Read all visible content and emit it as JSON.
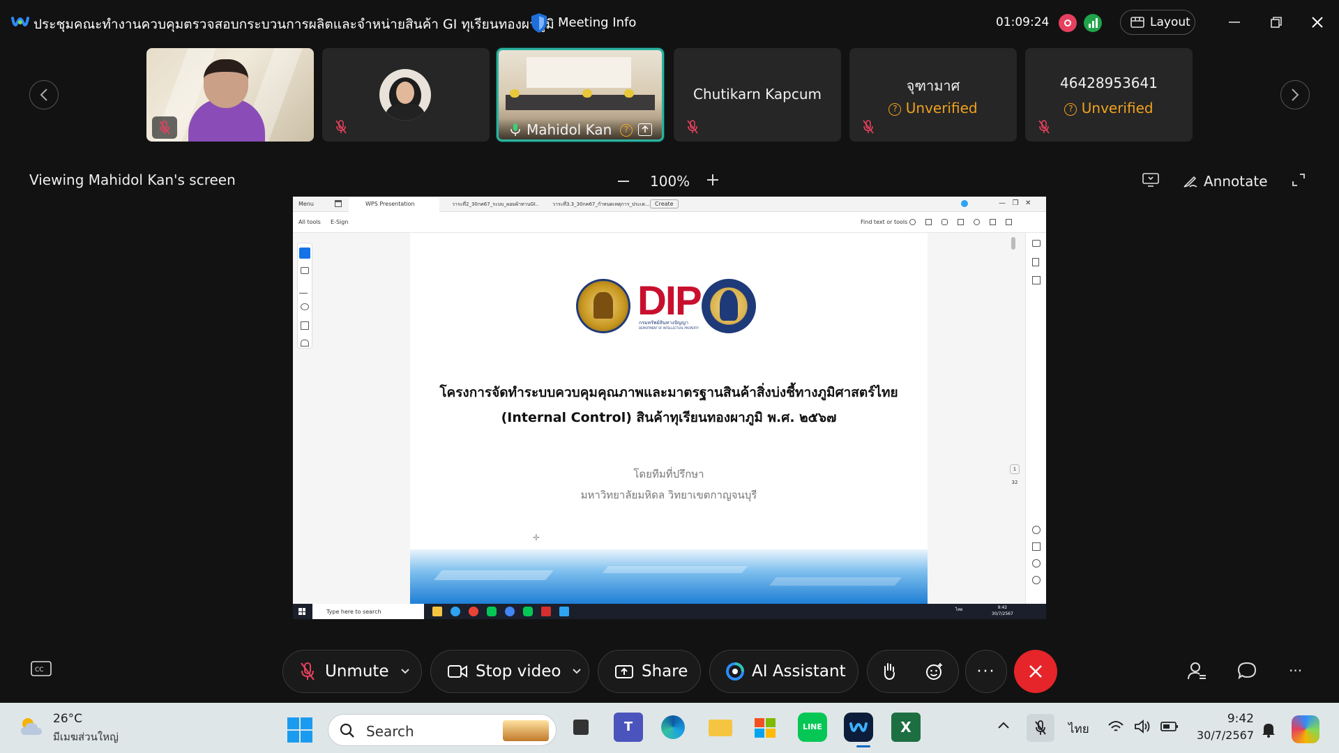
{
  "window": {
    "title": "ประชุมคณะทำงานควบคุมตรวจสอบกระบวนการผลิตและจำหน่ายสินค้า GI ทุเรียนทองผาภูมิ",
    "meeting_info_label": "Meeting Info",
    "timer": "01:09:24",
    "layout_label": "Layout"
  },
  "participants": [
    {
      "name": "",
      "icon": "video-person"
    },
    {
      "name": "",
      "icon": "avatar"
    },
    {
      "name": "Mahidol Kan",
      "active": true
    },
    {
      "name": "Chutikarn Kapcum"
    },
    {
      "name": "จุฑามาศ",
      "status": "Unverified"
    },
    {
      "name": "46428953641",
      "status": "Unverified"
    }
  ],
  "viewer": {
    "label": "Viewing Mahidol Kan's screen",
    "zoom": "100%",
    "annotate_label": "Annotate"
  },
  "shared": {
    "tabs": [
      "Menu",
      "WPS Presentation",
      "วาระที่2_30กค67_ระบบ_ผอมผ้าทานGI..",
      "วาระที่3.3_30กค67_กำหนดเหตุการ_ประเด...",
      "Create"
    ],
    "subtabs": [
      "All tools",
      "E-Sign"
    ],
    "find_label": "Find text or tools",
    "logo_text": "DIP",
    "logo_sub": "กรมทรัพย์สินทางปัญญา",
    "logo_sub2": "DEPARTMENT OF INTELLECTUAL PROPERTY",
    "slide_title1": "โครงการจัดทำระบบควบคุมคุณภาพและมาตรฐานสินค้าสิ่งบ่งชี้ทางภูมิศาสตร์ไทย",
    "slide_title2": "(Internal Control) สินค้าทุเรียนทองผาภูมิ พ.ศ. ๒๕๖๗",
    "slide_by": "โดยทีมที่ปรึกษา",
    "slide_org": "มหาวิทยาลัยมหิดล วิทยาเขตกาญจนบุรี",
    "page_current": "1",
    "page_total": "32",
    "inner_search": "Type here to search",
    "inner_time": "9:42",
    "inner_date": "30/7/2567",
    "inner_lang": "ไทย"
  },
  "controls": {
    "unmute": "Unmute",
    "stop_video": "Stop video",
    "share": "Share",
    "ai": "AI Assistant"
  },
  "taskbar": {
    "temp": "26°C",
    "weather": "มีเมฆส่วนใหญ่",
    "search": "Search",
    "lang": "ไทย",
    "time": "9:42",
    "date": "30/7/2567"
  },
  "colors": {
    "accent": "#2bb3a0",
    "end_call": "#e5252a",
    "unverified": "#f0a21f",
    "dip_red": "#c8102e"
  }
}
